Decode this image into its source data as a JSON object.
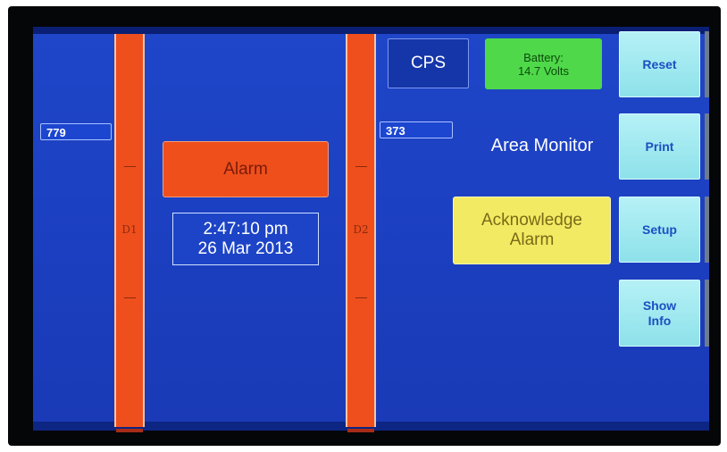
{
  "detectors": [
    {
      "label": "D1",
      "readout": "779"
    },
    {
      "label": "D2",
      "readout": "373"
    }
  ],
  "alarm": {
    "label": "Alarm"
  },
  "clock": {
    "time": "2:47:10 pm",
    "date": "26 Mar 2013"
  },
  "units": {
    "label": "CPS"
  },
  "battery": {
    "line1": "Battery:",
    "line2": "14.7 Volts"
  },
  "title": "Area Monitor",
  "acknowledge": {
    "line1": "Acknowledge",
    "line2": "Alarm"
  },
  "buttons": {
    "reset": "Reset",
    "print": "Print",
    "setup": "Setup",
    "show_info_line1": "Show",
    "show_info_line2": "Info"
  },
  "colors": {
    "screen": "#1f46c9",
    "bar": "#ef4f1c",
    "alarm": "#ee4f1b",
    "battery_ok": "#4fd84a",
    "acknowledge": "#f2ea63",
    "side_button": "#a6ecf2"
  }
}
